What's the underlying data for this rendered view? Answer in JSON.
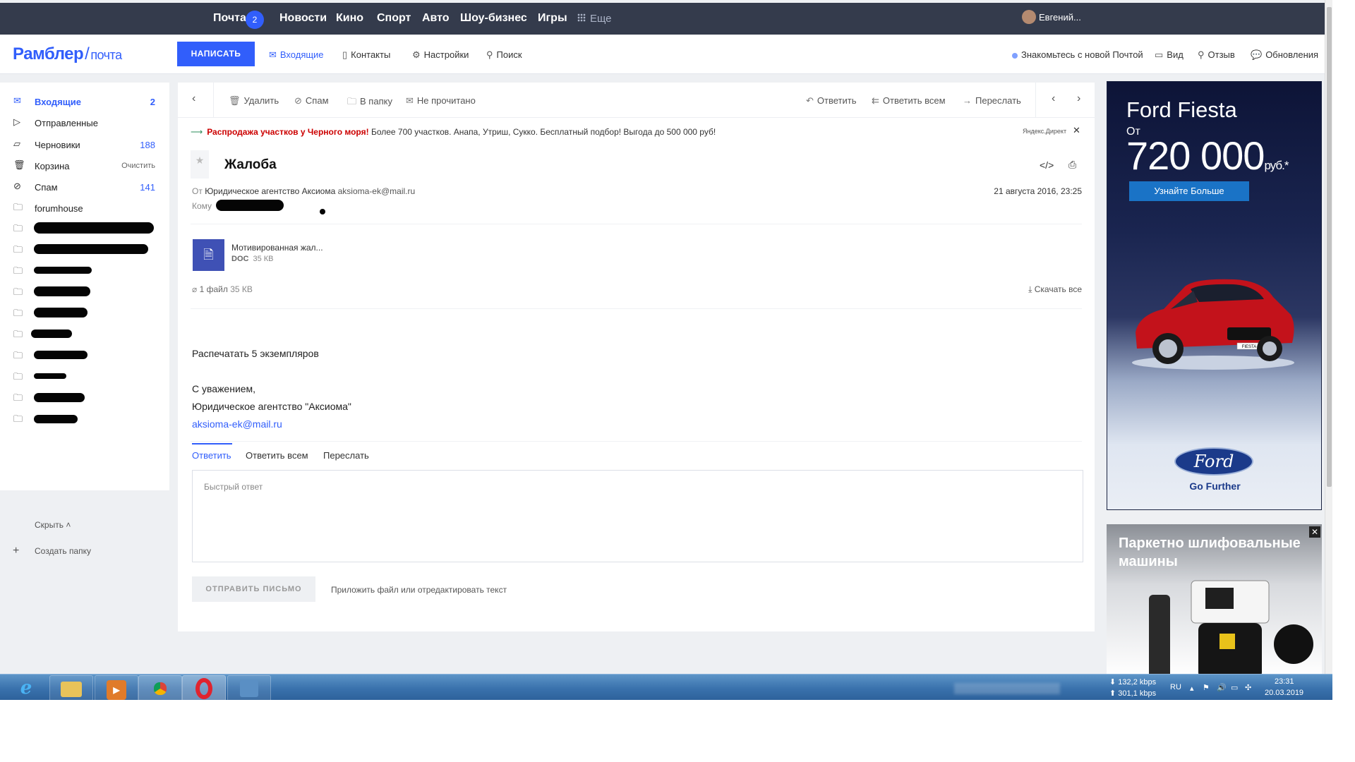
{
  "topnav": {
    "items": [
      "Почта",
      "Новости",
      "Кино",
      "Спорт",
      "Авто",
      "Шоу-бизнес",
      "Игры"
    ],
    "mail_badge": "2",
    "more": "Еще",
    "user": "Евгений..."
  },
  "header": {
    "logo_main": "Рамблер",
    "logo_sub": "почта",
    "compose": "НАПИСАТЬ",
    "inbox": "Входящие",
    "contacts": "Контакты",
    "settings": "Настройки",
    "search": "Поиск",
    "new_mail": "Знакомьтесь с новой Почтой",
    "view": "Вид",
    "feedback": "Отзыв",
    "updates": "Обновления"
  },
  "sidebar": {
    "folders": [
      {
        "name": "Входящие",
        "count": "2"
      },
      {
        "name": "Отправленные",
        "count": ""
      },
      {
        "name": "Черновики",
        "count": "188"
      },
      {
        "name": "Корзина",
        "action": "Очистить"
      },
      {
        "name": "Спам",
        "count": "141"
      },
      {
        "name": "forumhouse",
        "count": ""
      }
    ],
    "hide": "Скрыть",
    "create_folder": "Создать папку"
  },
  "toolbar": {
    "delete": "Удалить",
    "spam": "Спам",
    "to_folder": "В папку",
    "unread": "Не прочитано",
    "reply": "Ответить",
    "reply_all": "Ответить всем",
    "forward": "Переслать"
  },
  "ad_strip": {
    "highlight": "Распродажа участков у Черного моря!",
    "text": "Более 700 участков. Анапа, Утриш, Сукко. Бесплатный подбор! Выгода до 500 000 руб!",
    "source": "Яндекс.Директ"
  },
  "message": {
    "subject": "Жалоба",
    "from_label": "От",
    "from_name": "Юридическое агентство Аксиома",
    "from_email": "aksioma-ek@mail.ru",
    "to_label": "Кому",
    "date": "21 августа 2016, 23:25",
    "attachment": {
      "name": "Мотивированная жал...",
      "type": "DOC",
      "size": "35 КВ"
    },
    "files_count": "1 файл",
    "files_size": "35 КВ",
    "download_all": "Скачать все",
    "body": [
      "Распечатать 5 экземпляров",
      "",
      "С уважением,",
      "Юридическое агентство \"Аксиома\""
    ],
    "signature_link": "aksioma-ek@mail.ru"
  },
  "reply": {
    "tab_reply": "Ответить",
    "tab_reply_all": "Ответить всем",
    "tab_forward": "Переслать",
    "placeholder": "Быстрый ответ",
    "send": "ОТПРАВИТЬ ПИСЬМО",
    "attach": "Приложить файл или отредактировать текст"
  },
  "ads": {
    "ford_title": "Ford Fiesta",
    "ford_from": "От",
    "ford_price": "720 000",
    "ford_currency": "руб.*",
    "ford_button": "Узнайте Больше",
    "ford_logo": "Ford",
    "ford_slogan": "Go Further",
    "ford_plate": "FIESTA",
    "parquet_title": "Паркетно шлифовальные машины"
  },
  "taskbar": {
    "download_speed": "132,2 kbps",
    "upload_speed": "301,1 kbps",
    "lang": "RU",
    "time": "23:31",
    "date": "20.03.2019"
  },
  "colors": {
    "accent": "#315efb",
    "topnav_bg": "#343b4c",
    "ad_red": "#cc0000",
    "attachment_bg": "#3f51b5"
  }
}
